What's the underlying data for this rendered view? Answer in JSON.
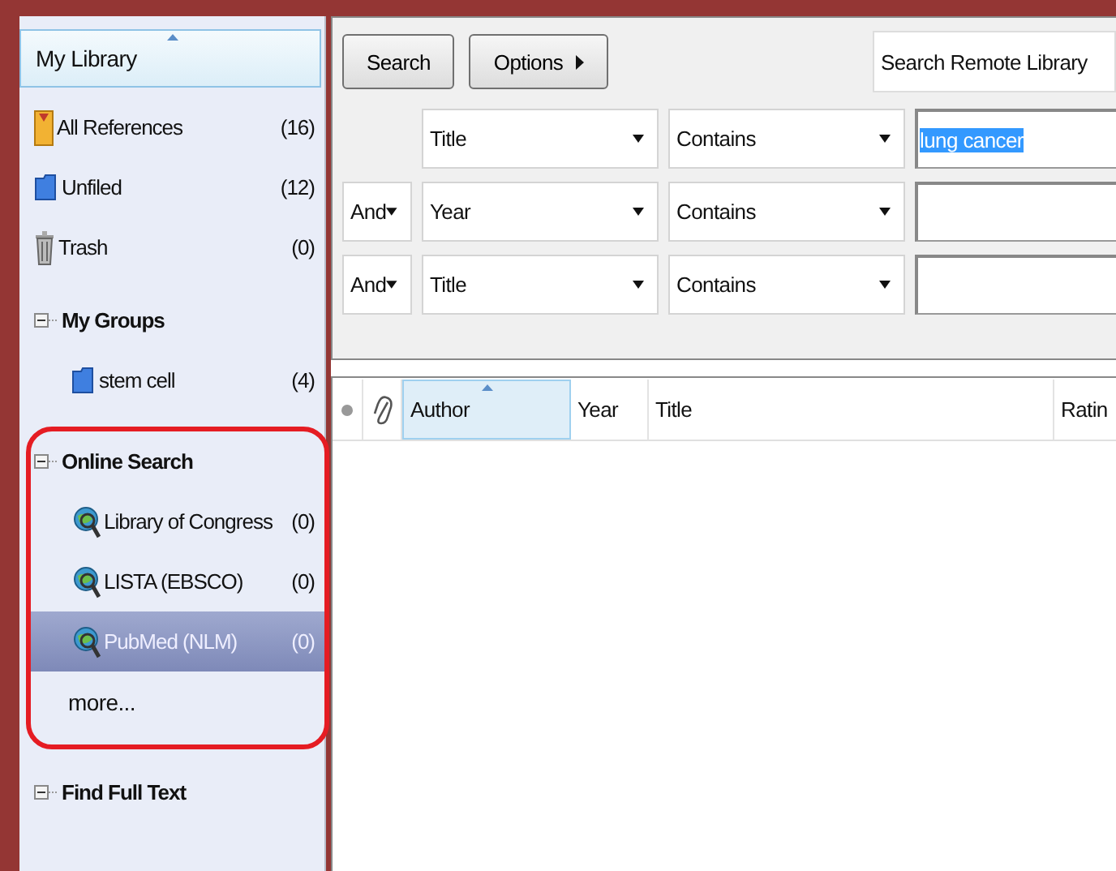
{
  "sidebar": {
    "header": {
      "label": "My Library",
      "sorted": true
    },
    "library_items": [
      {
        "kind": "references",
        "label": "All References",
        "count": "(16)",
        "selected": false
      },
      {
        "kind": "folder",
        "label": "Unfiled",
        "count": "(12)",
        "selected": false
      },
      {
        "kind": "trash",
        "label": "Trash",
        "count": "(0)",
        "selected": false
      }
    ],
    "groups": [
      {
        "title": "My Groups",
        "expanded": true,
        "annotated": false,
        "items": [
          {
            "kind": "folder",
            "label": "stem cell",
            "count": "(4)",
            "selected": false
          }
        ]
      },
      {
        "title": "Online Search",
        "expanded": true,
        "annotated": true,
        "items": [
          {
            "kind": "online-source",
            "label": "Library of Congress",
            "count": "(0)",
            "selected": false
          },
          {
            "kind": "online-source",
            "label": "LISTA (EBSCO)",
            "count": "(0)",
            "selected": false
          },
          {
            "kind": "online-source",
            "label": "PubMed (NLM)",
            "count": "(0)",
            "selected": true
          }
        ],
        "more": "more..."
      },
      {
        "title": "Find Full Text",
        "expanded": true,
        "annotated": false
      }
    ]
  },
  "search_panel": {
    "buttons": [
      {
        "label": "Search",
        "kind": "plain"
      },
      {
        "label": "Options",
        "kind": "menu"
      }
    ],
    "mode": "Search Remote Library",
    "rows": [
      {
        "field": "Title",
        "operator": "Contains",
        "value": "lung cancer",
        "value_selected": true
      },
      {
        "connector": "And",
        "field": "Year",
        "operator": "Contains"
      },
      {
        "connector": "And",
        "field": "Title",
        "operator": "Contains"
      }
    ]
  },
  "table": {
    "columns": [
      {
        "kind": "dot"
      },
      {
        "kind": "attachment"
      },
      {
        "kind": "text",
        "label": "Author",
        "sorted": true
      },
      {
        "kind": "text",
        "label": "Year",
        "sorted": false
      },
      {
        "kind": "text",
        "label": "Title",
        "sorted": false
      },
      {
        "kind": "text",
        "label": "Ratin",
        "sorted": false
      }
    ]
  }
}
